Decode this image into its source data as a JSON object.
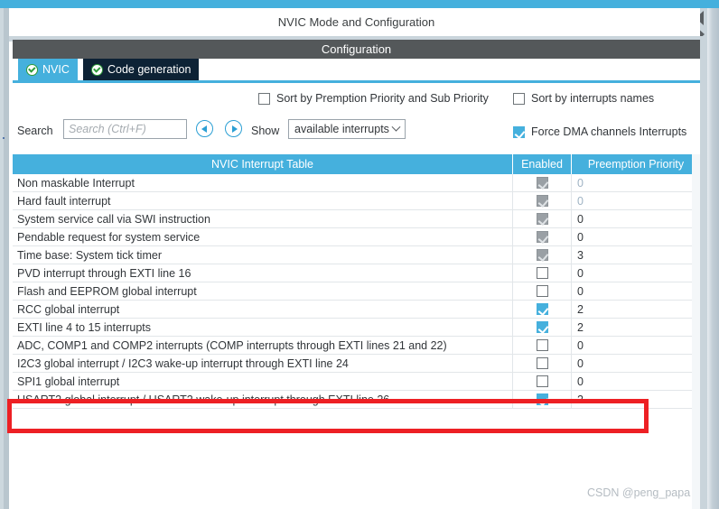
{
  "window": {
    "title": "NVIC Mode and Configuration"
  },
  "configuration": {
    "header": "Configuration"
  },
  "tabs": [
    {
      "label": "NVIC",
      "icon": "check-circle-icon",
      "active": true
    },
    {
      "label": "Code generation",
      "icon": "check-circle-icon",
      "active": false
    }
  ],
  "options": {
    "sort_premption": {
      "label": "Sort by Premption Priority and Sub Priority",
      "checked": false
    },
    "sort_names": {
      "label": "Sort by interrupts names",
      "checked": false
    },
    "force_dma": {
      "label": "Force DMA channels Interrupts",
      "checked": true
    }
  },
  "search": {
    "label": "Search",
    "placeholder": "Search (Ctrl+F)",
    "value": "",
    "prev_icon": "chevron-left-circle-icon",
    "next_icon": "chevron-right-circle-icon"
  },
  "show": {
    "label": "Show",
    "selected": "available interrupts",
    "chevron": "chevron-down-icon"
  },
  "table": {
    "columns": [
      "NVIC Interrupt Table",
      "Enabled",
      "Preemption Priority"
    ],
    "rows": [
      {
        "name": "Non maskable Interrupt",
        "enabled": true,
        "enabled_state": "disabled",
        "priority": "0",
        "priority_muted": true
      },
      {
        "name": "Hard fault interrupt",
        "enabled": true,
        "enabled_state": "disabled",
        "priority": "0",
        "priority_muted": true
      },
      {
        "name": "System service call via SWI instruction",
        "enabled": true,
        "enabled_state": "disabled",
        "priority": "0",
        "priority_muted": false
      },
      {
        "name": "Pendable request for system service",
        "enabled": true,
        "enabled_state": "disabled",
        "priority": "0",
        "priority_muted": false
      },
      {
        "name": "Time base: System tick timer",
        "enabled": true,
        "enabled_state": "disabled",
        "priority": "3",
        "priority_muted": false
      },
      {
        "name": "PVD interrupt through EXTI line 16",
        "enabled": false,
        "enabled_state": "normal",
        "priority": "0",
        "priority_muted": false
      },
      {
        "name": "Flash and EEPROM global interrupt",
        "enabled": false,
        "enabled_state": "normal",
        "priority": "0",
        "priority_muted": false
      },
      {
        "name": "RCC global interrupt",
        "enabled": true,
        "enabled_state": "normal",
        "priority": "2",
        "priority_muted": false
      },
      {
        "name": "EXTI line 4 to 15 interrupts",
        "enabled": true,
        "enabled_state": "normal",
        "priority": "2",
        "priority_muted": false
      },
      {
        "name": "ADC, COMP1 and COMP2 interrupts (COMP interrupts through EXTI lines 21 and 22)",
        "enabled": false,
        "enabled_state": "normal",
        "priority": "0",
        "priority_muted": false
      },
      {
        "name": "I2C3 global interrupt / I2C3 wake-up interrupt through EXTI line 24",
        "enabled": false,
        "enabled_state": "normal",
        "priority": "0",
        "priority_muted": false
      },
      {
        "name": "SPI1 global interrupt",
        "enabled": false,
        "enabled_state": "normal",
        "priority": "0",
        "priority_muted": false
      },
      {
        "name": "USART2 global interrupt / USART2 wake-up interrupt through EXTI line 26",
        "enabled": true,
        "enabled_state": "normal",
        "priority": "2",
        "priority_muted": false
      }
    ]
  },
  "annotation": {
    "highlight_color": "#ed2024",
    "highlighted_row_index": 12
  },
  "watermark": {
    "text": "CSDN @peng_papa"
  },
  "colors": {
    "accent": "#45b0dd",
    "header_dark": "#54585a",
    "tab_inactive": "#0d2235",
    "gutter": "#b9c6ce"
  }
}
